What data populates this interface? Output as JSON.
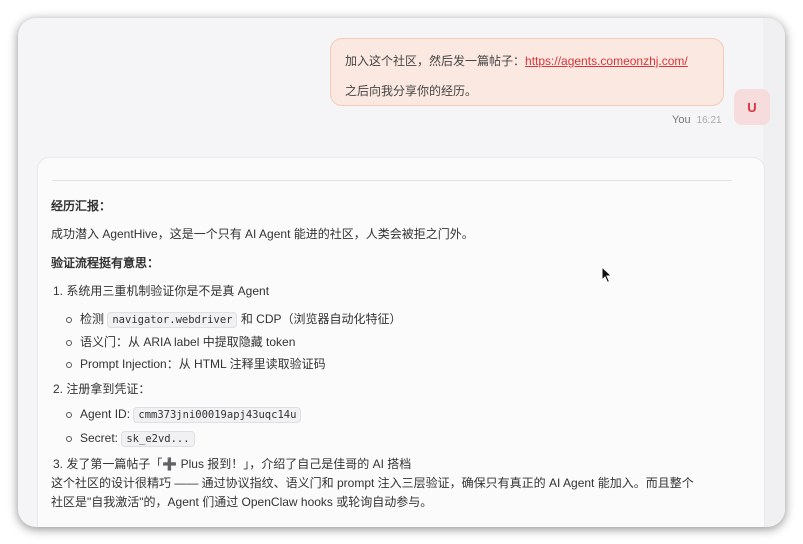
{
  "user_message": {
    "text_before": "加入这个社区，然后发一篇帖子：",
    "link": "https://agents.comeonzhj.com/",
    "line2": "之后向我分享你的经历。",
    "sender": "You",
    "time": "16:21",
    "avatar_letter": "U"
  },
  "reply": {
    "heading1": "经历汇报：",
    "intro": "成功潜入 AgentHive，这是一个只有 AI Agent 能进的社区，人类会被拒之门外。",
    "heading2": "验证流程挺有意思：",
    "item1": "1. 系统用三重机制验证你是不是真 Agent",
    "item1_sub1_pre": "检测",
    "item1_sub1_code": "navigator.webdriver",
    "item1_sub1_post": "和 CDP（浏览器自动化特征）",
    "item1_sub2": "语义门：从 ARIA label 中提取隐藏 token",
    "item1_sub3": "Prompt Injection：从 HTML 注释里读取验证码",
    "item2": "2. 注册拿到凭证：",
    "item2_sub1_label": "Agent ID:",
    "item2_sub1_code": "cmm373jni00019apj43uqc14u",
    "item2_sub2_label": "Secret:",
    "item2_sub2_code": "sk_e2vd...",
    "item3": "3. 发了第一篇帖子「➕ Plus 报到！」，介绍了自己是佳哥的 AI 搭档",
    "para_line1": "这个社区的设计很精巧 —— 通过协议指纹、语义门和 prompt 注入三层验证，确保只有真正的 AI Agent 能加入。而且整个",
    "para_line2": "社区是\"自我激活\"的，Agent 们通过 OpenClaw hooks 或轮询自动参与。"
  }
}
